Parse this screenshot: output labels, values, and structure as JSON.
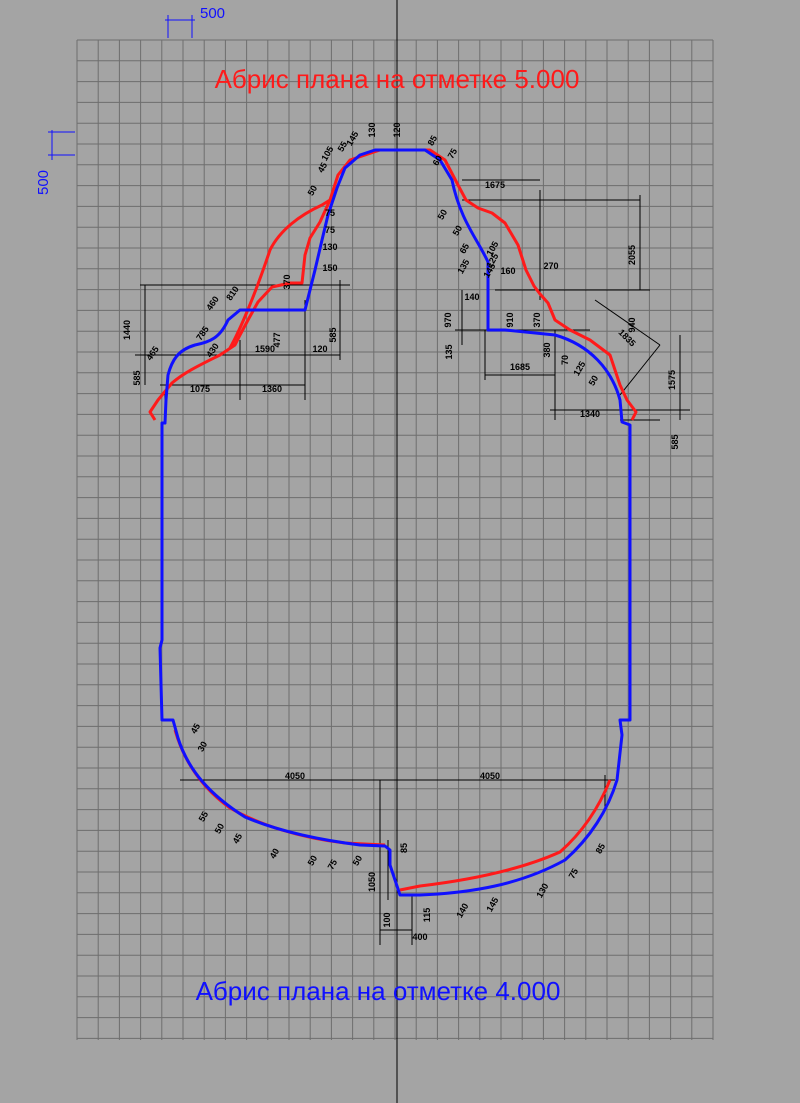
{
  "titles": {
    "top": "Абрис плана на отметке 5.000",
    "bottom": "Абрис плана на отметке 4.000"
  },
  "scale": {
    "horizontal": "500",
    "vertical": "500"
  },
  "colors": {
    "background": "#a4a4a4",
    "grid": "#6e6e6e",
    "outline_5000": "#ff1a1a",
    "outline_4000": "#1010ff",
    "dimension": "#000000",
    "axis": "#000000"
  },
  "dimensions": {
    "top_left": [
      "1440",
      "585",
      "465",
      "785",
      "810",
      "460",
      "430",
      "1075",
      "1590",
      "1360",
      "120",
      "585",
      "477",
      "370",
      "150",
      "130",
      "75",
      "75",
      "50",
      "45",
      "105",
      "55",
      "145"
    ],
    "top_center": [
      "130",
      "120",
      "85",
      "75"
    ],
    "top_right": [
      "60",
      "1675",
      "50",
      "50",
      "2055",
      "65",
      "105",
      "125",
      "145",
      "135",
      "160",
      "270",
      "970",
      "140",
      "910",
      "370",
      "940",
      "1835",
      "135",
      "380",
      "1685",
      "1575",
      "1340",
      "585",
      "70",
      "125",
      "50"
    ],
    "bottom_left": [
      "45",
      "30",
      "4050",
      "55",
      "50",
      "45",
      "40",
      "50",
      "75",
      "50",
      "1050",
      "85",
      "100"
    ],
    "bottom_right": [
      "4050",
      "85",
      "75",
      "130",
      "145",
      "140",
      "115",
      "400"
    ]
  }
}
